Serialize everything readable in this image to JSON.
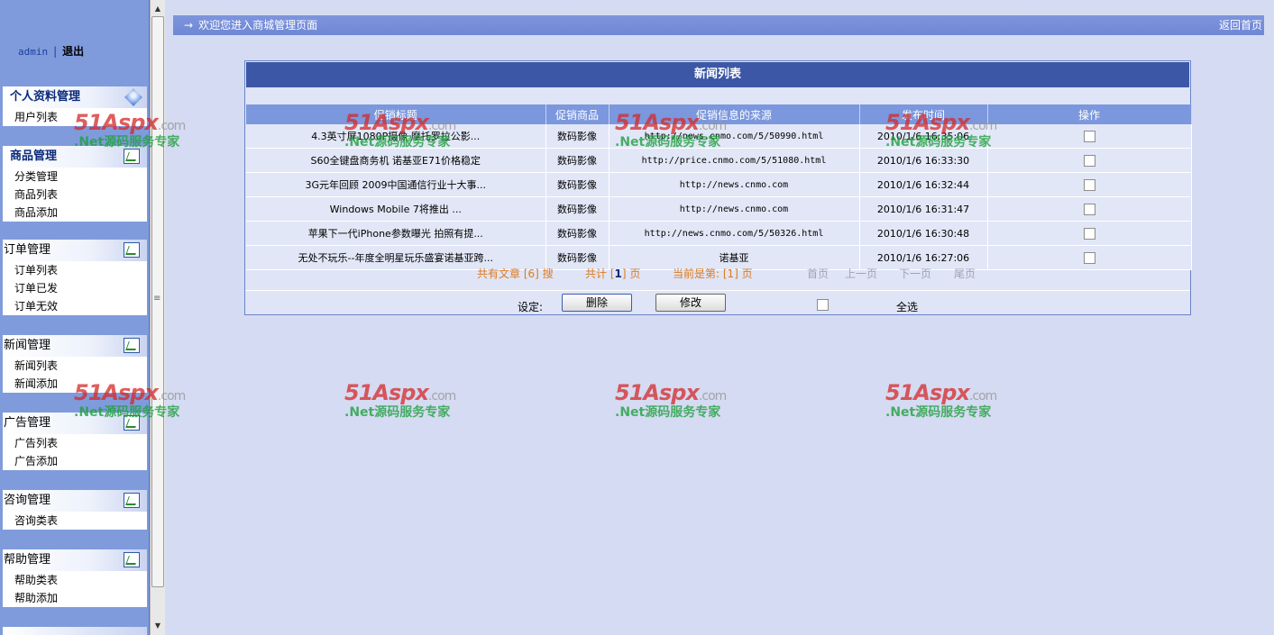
{
  "sidebar": {
    "user": "admin",
    "separator": "|",
    "logout": "退出",
    "groups": [
      {
        "title": "个人资料管理",
        "items": [
          "用户列表"
        ]
      },
      {
        "title": "商品管理",
        "items": [
          "分类管理",
          "商品列表",
          "商品添加"
        ]
      },
      {
        "title": "订单管理",
        "items": [
          "订单列表",
          "订单已发",
          "订单无效"
        ]
      },
      {
        "title": "新闻管理",
        "items": [
          "新闻列表",
          "新闻添加"
        ]
      },
      {
        "title": "广告管理",
        "items": [
          "广告列表",
          "广告添加"
        ]
      },
      {
        "title": "咨询管理",
        "items": [
          "咨询类表"
        ]
      },
      {
        "title": "帮助管理",
        "items": [
          "帮助类表",
          "帮助添加"
        ]
      }
    ]
  },
  "topbar": {
    "arrow": "→",
    "welcome": "欢迎您进入商城管理页面",
    "back": "返回首页"
  },
  "panel": {
    "title": "新闻列表",
    "columns": [
      "促销标题",
      "促销商品",
      "促销信息的来源",
      "发布时间",
      "操作"
    ],
    "rows": [
      {
        "title": "4.3英寸屏1080P摄像 摩托罗拉公影...",
        "product": "数码影像",
        "source": "http://news.cnmo.com/5/50990.html",
        "time": "2010/1/6 16:35:06"
      },
      {
        "title": "S60全键盘商务机 诺基亚E71价格稳定",
        "product": "数码影像",
        "source": "http://price.cnmo.com/5/51080.html",
        "time": "2010/1/6 16:33:30"
      },
      {
        "title": "3G元年回顾 2009中国通信行业十大事...",
        "product": "数码影像",
        "source": "http://news.cnmo.com",
        "time": "2010/1/6 16:32:44"
      },
      {
        "title": "Windows Mobile 7将推出 ...",
        "product": "数码影像",
        "source": "http://news.cnmo.com",
        "time": "2010/1/6 16:31:47"
      },
      {
        "title": "苹果下一代iPhone参数曝光 拍照有提...",
        "product": "数码影像",
        "source": "http://news.cnmo.com/5/50326.html",
        "time": "2010/1/6 16:30:48"
      },
      {
        "title": "无处不玩乐--年度全明星玩乐盛宴诺基亚跨...",
        "product": "数码影像",
        "source": "诺基亚",
        "time": "2010/1/6 16:27:06"
      }
    ],
    "pager": {
      "total_prefix": "共有文章 [",
      "total_count": "6",
      "total_suffix": "] 搜",
      "pages_prefix": "共计 [",
      "pages_count": "1",
      "pages_suffix": "] 页",
      "current_prefix": "当前是第: [",
      "current_page": "1",
      "current_suffix": "] 页",
      "first": "首页",
      "prev": "上一页",
      "next": "下一页",
      "last": "尾页"
    },
    "actions": {
      "set_label": "设定:",
      "delete": "删除",
      "edit": "修改",
      "select_all": "全选"
    }
  },
  "watermark": {
    "logo": "51Aspx",
    "domain": ".com",
    "tagline": ".Net源码服务专家"
  },
  "colors": {
    "sidebar_bg": "#7f9bdc",
    "page_bg": "#d5dbf2",
    "title_bar": "#3c57a6",
    "header_row": "#7b97dd",
    "pager_orange": "#e07a1a"
  }
}
